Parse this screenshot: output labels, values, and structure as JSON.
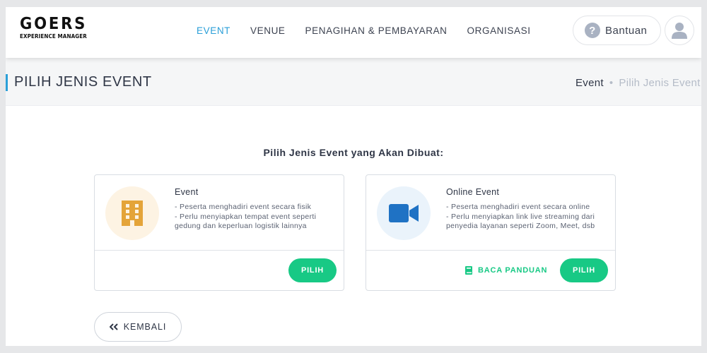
{
  "header": {
    "logo_main": "GOERS",
    "logo_sub": "EXPERIENCE MANAGER",
    "nav": [
      {
        "label": "EVENT",
        "active": true
      },
      {
        "label": "VENUE",
        "active": false
      },
      {
        "label": "PENAGIHAN & PEMBAYARAN",
        "active": false
      },
      {
        "label": "ORGANISASI",
        "active": false
      }
    ],
    "help_label": "Bantuan",
    "help_icon": "question-circle-icon",
    "avatar_icon": "user-icon"
  },
  "subheader": {
    "title": "PILIH JENIS EVENT",
    "breadcrumb": [
      "Event",
      "•",
      "Pilih Jenis Event"
    ]
  },
  "main": {
    "heading": "Pilih Jenis Event yang Akan Dibuat:",
    "cards": [
      {
        "title": "Event",
        "icon": "building-icon",
        "desc": [
          "- Peserta menghadiri event secara fisik",
          "- Perlu menyiapkan tempat event seperti",
          "gedung dan keperluan logistik lainnya"
        ],
        "select_label": "PILIH"
      },
      {
        "title": "Online Event",
        "icon": "video-camera-icon",
        "desc": [
          "- Peserta menghadiri event secara online",
          "- Perlu menyiapkan link live streaming dari",
          "penyedia layanan seperti Zoom, Meet, dsb"
        ],
        "guide_label": "BACA PANDUAN",
        "guide_icon": "book-icon",
        "select_label": "PILIH"
      }
    ],
    "back_label": "KEMBALI",
    "back_icon": "double-chevron-left-icon"
  },
  "colors": {
    "accent_blue": "#2a9fd8",
    "accent_green": "#18c985",
    "building_orange": "#e4a439",
    "video_blue": "#1f72c4"
  }
}
